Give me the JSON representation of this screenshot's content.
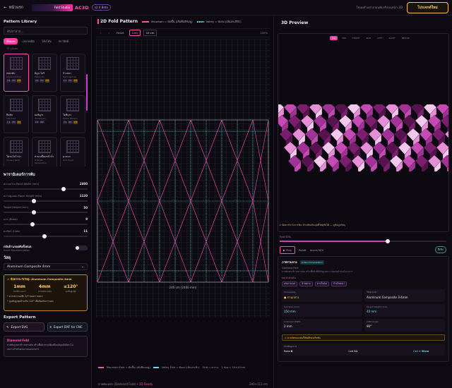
{
  "header": {
    "back_label": "หน้าแรก",
    "logo_text": "Fold Studio",
    "brand": "AC3D",
    "version": "v2.0 Beta",
    "tip": "โหลดตัวอย่างก่อนพับจริงบนหน้า 3D",
    "new_button": "โปรเจกต์ใหม่"
  },
  "library": {
    "title": "Pattern Library",
    "search_placeholder": "ค้นหาลาย...",
    "tabs": [
      "ทั้งหมด",
      "เรขาคณิต",
      "โค้งโค้ง",
      "สถาปัตย์"
    ],
    "active_tab": 0,
    "subnote": "13 รูปแบบ",
    "patterns": [
      {
        "name": "เพชรพับ",
        "en": "Diamond Fold",
        "badges": [
          "3:4",
          "MV",
          "ยาก"
        ]
      },
      {
        "name": "มิอูระโอริ",
        "en": "Miura-Ori",
        "badges": [
          "3:2",
          "MV",
          "ยาก"
        ]
      },
      {
        "name": "ก้างปลา",
        "en": "Herringbone",
        "badges": [
          "1:1",
          "MV",
          "ยาก"
        ]
      },
      {
        "name": "ลีบพับ",
        "en": "Kite Fold",
        "badges": [
          "1:1",
          "MV",
          "ง่าย"
        ]
      },
      {
        "name": "ยอชิมูระ",
        "en": "Yoshimura",
        "badges": [
          "2:1",
          "MV"
        ]
      },
      {
        "name": "โยชิมุระ",
        "en": "Resch Pattern",
        "badges": [
          "3:2",
          "MV",
          "ยาก"
        ]
      },
      {
        "name": "โครนโคโรน่า",
        "en": "Square Twist",
        "badges": []
      },
      {
        "name": "สามเหลี่ยมหน้าจั่ว",
        "en": "Triangle Tessellation",
        "badges": []
      },
      {
        "name": "ฐานนก",
        "en": "Grid Pleat",
        "badges": []
      }
    ]
  },
  "params": {
    "title": "พารามิเตอร์การพับ",
    "items": [
      {
        "label": "ความกว้าง Panel Width (mm)",
        "value": "2400",
        "pos": 0.72
      },
      {
        "label": "ความสูงแผ่น Panel Height (mm)",
        "value": "1120",
        "pos": 0.35
      },
      {
        "label": "Target Height (mm)",
        "value": "50",
        "pos": 0.35
      },
      {
        "label": "แถว (Rows)",
        "value": "8",
        "pos": 0.33
      },
      {
        "label": "คอลัมน์ (Cols)",
        "value": "11",
        "pos": 0.48
      }
    ],
    "toggle_title": "กลับด้านรอยพับทั้งหมด",
    "toggle_sub": "Invert Mountain/Valley"
  },
  "material": {
    "title": "วัสดุ",
    "selected": "Aluminum Composite 4mm",
    "warn_title": "ข้อควรระวังวัสดุ: Aluminum Composite 4mm",
    "stats": [
      {
        "v": "1mm",
        "l": "ร่องพับ (Kerf)"
      },
      {
        "v": "4mm",
        "l": "ความหนาแผ่น"
      },
      {
        "v": "≤120°",
        "l": "มุมพับสูงสุด"
      }
    ],
    "notes": [
      "• ควรเซาะร่องลึก 2/3 ของความหนา",
      "• มุมพับสูงสุดห้ามเกิน 120° เพื่อป้องกันการแตก"
    ]
  },
  "export": {
    "title": "Export Pattern",
    "svg": "Export SVG",
    "dxf": "Export DXF for CNC"
  },
  "description": {
    "name": "Diamond Fold",
    "text": "ลายพับรูปทรงข้าวหลามตัด สร้างพื้นผิวสามมิติเหมือนอัญมณีเจียระไน",
    "sub": "เหมาะสำหรับผนังภายนอกอาคาร"
  },
  "pattern2d": {
    "title": "2D Fold Pattern",
    "legend_mountain": "Mountain = พับขึ้น (เส้นทึบสีชมพู)",
    "legend_valley": "Valley = พับลง (เส้นประสีฟ้า)",
    "tools": [
      "Reset",
      "Grid"
    ],
    "unit": "10 cm",
    "zoom": "100%",
    "dim_label": "240 cm (2400 mm)",
    "foot_mountain": "Mountain Fold = พับขึ้น (เส้นทึบชมพู)",
    "foot_valley": "Valley Fold = พับลง (เส้นประฟ้า)",
    "foot_grid": "Grid = ตาราง",
    "foot_scale": "1 ช่อง = 10×10 cm",
    "status_left": "ลายพับเพชร (Diamond Fold)",
    "status_ready": "• 3D Ready",
    "status_right": "240×112 cm"
  },
  "preview": {
    "title": "3D Preview",
    "views": [
      "ISO",
      "TOP",
      "FRONT",
      "SIDE",
      "LEFT",
      "RIGHT",
      "BELOW"
    ],
    "active_view": 0,
    "warn": "⚠ ข้อควรระวังการพับ: ห้ามพับเกินมุมที่วัสดุรับได้ — ดูข้อมูลวัสดุ",
    "fold_label": "Fold 65%",
    "fold_value": 0.65,
    "play": "▶ Play",
    "reset": "Reset",
    "invert": "Invert M/V",
    "color_mode": "สีจริง"
  },
  "analysis": {
    "title": "ภาพรวมลาย",
    "badge": "AI Recommendation",
    "pattern": "Diamond Fold",
    "line1": "ลายพับทรงข้าวหลามตัด สร้างพื้นผิวที่มีมิติสูงเหมาะกับผนังด้านหน้าอาคาร",
    "chips_label": "แนะนำสำหรับ",
    "chips": [
      "ผนังภายนอก",
      "ฝ้าเพดาน",
      "ฉากกั้นห้อง",
      "ป้ายโฆษณา"
    ],
    "cells": [
      {
        "l": "Complexity",
        "v": "● ปานกลาง",
        "c": "y"
      },
      {
        "l": "วัสดุแนะนำ",
        "v": "Aluminum Composite 3-4mm",
        "c": ""
      },
      {
        "l": "Cell Size (mm)",
        "v": "150 mm",
        "c": "cy"
      },
      {
        "l": "Target Height (mm)",
        "v": "40 mm",
        "c": "cy"
      },
      {
        "l": "V-Groove Width",
        "v": "2 mm",
        "c": ""
      },
      {
        "l": "V-Bit Angle",
        "v": "90°",
        "c": ""
      }
    ],
    "warn": "⚠ ควรตัดขอบแผ่นให้พอดีก่อนเริ่มพับ",
    "summary_label": "สรุปข้อมูลลาย",
    "summary": [
      {
        "k": "Rows",
        "v": "8"
      },
      {
        "k": "Cols",
        "v": "11"
      },
      {
        "k": "Cell",
        "v": "≈ 30cm"
      }
    ]
  }
}
